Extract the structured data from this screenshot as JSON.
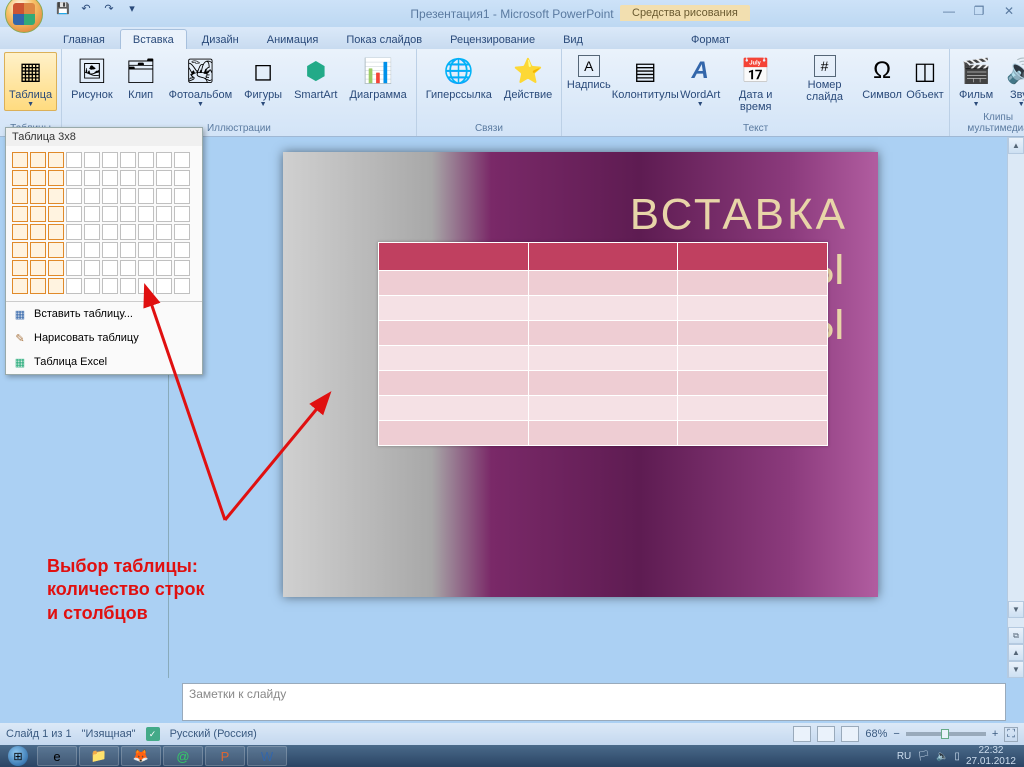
{
  "title": "Презентация1 - Microsoft PowerPoint",
  "context_tab": "Средства рисования",
  "tabs": [
    "Главная",
    "Вставка",
    "Дизайн",
    "Анимация",
    "Показ слайдов",
    "Рецензирование",
    "Вид",
    "Формат"
  ],
  "active_tab_index": 1,
  "ribbon": {
    "groups": [
      {
        "label": "Таблицы",
        "items": [
          {
            "label": "Таблица",
            "icon": "▦"
          }
        ]
      },
      {
        "label": "Иллюстрации",
        "items": [
          {
            "label": "Рисунок",
            "icon": "🖼"
          },
          {
            "label": "Клип",
            "icon": "🗂"
          },
          {
            "label": "Фотоальбом",
            "icon": "🏞"
          },
          {
            "label": "Фигуры",
            "icon": "◻"
          },
          {
            "label": "SmartArt",
            "icon": "⬢"
          },
          {
            "label": "Диаграмма",
            "icon": "📊"
          }
        ]
      },
      {
        "label": "Связи",
        "items": [
          {
            "label": "Гиперссылка",
            "icon": "🌐"
          },
          {
            "label": "Действие",
            "icon": "⭐"
          }
        ]
      },
      {
        "label": "Текст",
        "items": [
          {
            "label": "Надпись",
            "icon": "A"
          },
          {
            "label": "Колонтитулы",
            "icon": "▤"
          },
          {
            "label": "WordArt",
            "icon": "A"
          },
          {
            "label": "Дата и время",
            "icon": "📅"
          },
          {
            "label": "Номер слайда",
            "icon": "#"
          },
          {
            "label": "Символ",
            "icon": "Ω"
          },
          {
            "label": "Объект",
            "icon": "◫"
          }
        ]
      },
      {
        "label": "Клипы мультимедиа",
        "items": [
          {
            "label": "Фильм",
            "icon": "🎬"
          },
          {
            "label": "Звук",
            "icon": "🔊"
          }
        ]
      }
    ]
  },
  "table_dropdown": {
    "header": "Таблица 3x8",
    "selected_cols": 3,
    "selected_rows": 8,
    "menu": [
      {
        "label": "Вставить таблицу...",
        "icon": "▦"
      },
      {
        "label": "Нарисовать таблицу",
        "icon": "✎"
      },
      {
        "label": "Таблица Excel",
        "icon": "▦"
      }
    ]
  },
  "slide": {
    "title_line1": "ВСТАВКА",
    "title_line2": "Ы",
    "title_line3": "Ы"
  },
  "annotation": {
    "line1": "Выбор таблицы:",
    "line2": "количество строк",
    "line3": "и столбцов"
  },
  "notes_placeholder": "Заметки к слайду",
  "status": {
    "slide_info": "Слайд 1 из 1",
    "theme": "\"Изящная\"",
    "language": "Русский (Россия)",
    "zoom": "68%",
    "input_lang": "RU"
  },
  "clock": {
    "time": "22:32",
    "date": "27.01.2012"
  }
}
